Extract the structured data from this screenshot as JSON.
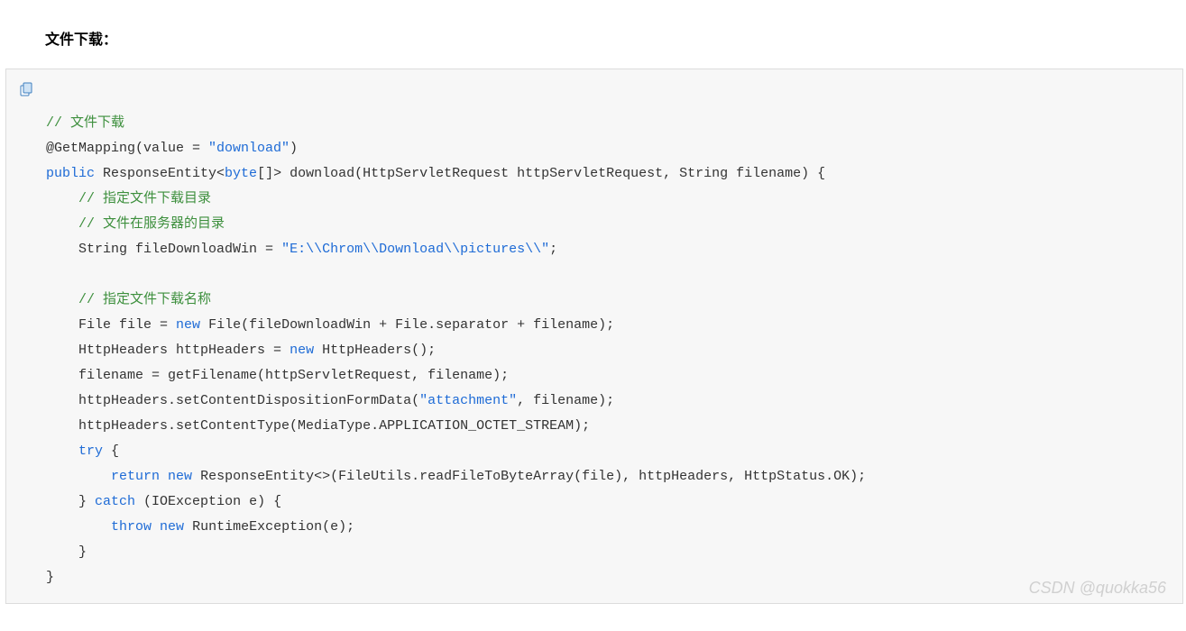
{
  "heading": "文件下载：",
  "watermark": "CSDN @quokka56",
  "code": {
    "tokens": [
      {
        "indent": 0,
        "parts": [
          {
            "t": "comment",
            "v": "// 文件下载"
          }
        ]
      },
      {
        "indent": 0,
        "parts": [
          {
            "t": "plain",
            "v": "@GetMapping(value = "
          },
          {
            "t": "string",
            "v": "\"download\""
          },
          {
            "t": "plain",
            "v": ")"
          }
        ]
      },
      {
        "indent": 0,
        "parts": [
          {
            "t": "keyword",
            "v": "public"
          },
          {
            "t": "plain",
            "v": " ResponseEntity<"
          },
          {
            "t": "keyword",
            "v": "byte"
          },
          {
            "t": "plain",
            "v": "[]> download(HttpServletRequest httpServletRequest, String filename) {"
          }
        ]
      },
      {
        "indent": 1,
        "parts": [
          {
            "t": "comment",
            "v": "// 指定文件下载目录"
          }
        ]
      },
      {
        "indent": 1,
        "parts": [
          {
            "t": "comment",
            "v": "// 文件在服务器的目录"
          }
        ]
      },
      {
        "indent": 1,
        "parts": [
          {
            "t": "plain",
            "v": "String fileDownloadWin = "
          },
          {
            "t": "string",
            "v": "\"E:\\\\Chrom\\\\Download\\\\pictures\\\\\""
          },
          {
            "t": "plain",
            "v": ";"
          }
        ]
      },
      {
        "indent": 0,
        "parts": [
          {
            "t": "plain",
            "v": ""
          }
        ]
      },
      {
        "indent": 1,
        "parts": [
          {
            "t": "comment",
            "v": "// 指定文件下载名称"
          }
        ]
      },
      {
        "indent": 1,
        "parts": [
          {
            "t": "plain",
            "v": "File file = "
          },
          {
            "t": "keyword",
            "v": "new"
          },
          {
            "t": "plain",
            "v": " File(fileDownloadWin + File.separator + filename);"
          }
        ]
      },
      {
        "indent": 1,
        "parts": [
          {
            "t": "plain",
            "v": "HttpHeaders httpHeaders = "
          },
          {
            "t": "keyword",
            "v": "new"
          },
          {
            "t": "plain",
            "v": " HttpHeaders();"
          }
        ]
      },
      {
        "indent": 1,
        "parts": [
          {
            "t": "plain",
            "v": "filename = getFilename(httpServletRequest, filename);"
          }
        ]
      },
      {
        "indent": 1,
        "parts": [
          {
            "t": "plain",
            "v": "httpHeaders.setContentDispositionFormData("
          },
          {
            "t": "string",
            "v": "\"attachment\""
          },
          {
            "t": "plain",
            "v": ", filename);"
          }
        ]
      },
      {
        "indent": 1,
        "parts": [
          {
            "t": "plain",
            "v": "httpHeaders.setContentType(MediaType.APPLICATION_OCTET_STREAM);"
          }
        ]
      },
      {
        "indent": 1,
        "parts": [
          {
            "t": "keyword",
            "v": "try"
          },
          {
            "t": "plain",
            "v": " {"
          }
        ]
      },
      {
        "indent": 2,
        "parts": [
          {
            "t": "keyword",
            "v": "return"
          },
          {
            "t": "plain",
            "v": " "
          },
          {
            "t": "keyword",
            "v": "new"
          },
          {
            "t": "plain",
            "v": " ResponseEntity<>(FileUtils.readFileToByteArray(file), httpHeaders, HttpStatus.OK);"
          }
        ]
      },
      {
        "indent": 1,
        "parts": [
          {
            "t": "plain",
            "v": "} "
          },
          {
            "t": "keyword",
            "v": "catch"
          },
          {
            "t": "plain",
            "v": " (IOException e) {"
          }
        ]
      },
      {
        "indent": 2,
        "parts": [
          {
            "t": "keyword",
            "v": "throw"
          },
          {
            "t": "plain",
            "v": " "
          },
          {
            "t": "keyword",
            "v": "new"
          },
          {
            "t": "plain",
            "v": " RuntimeException(e);"
          }
        ]
      },
      {
        "indent": 1,
        "parts": [
          {
            "t": "plain",
            "v": "}"
          }
        ]
      },
      {
        "indent": 0,
        "parts": [
          {
            "t": "plain",
            "v": "}"
          }
        ]
      }
    ]
  }
}
